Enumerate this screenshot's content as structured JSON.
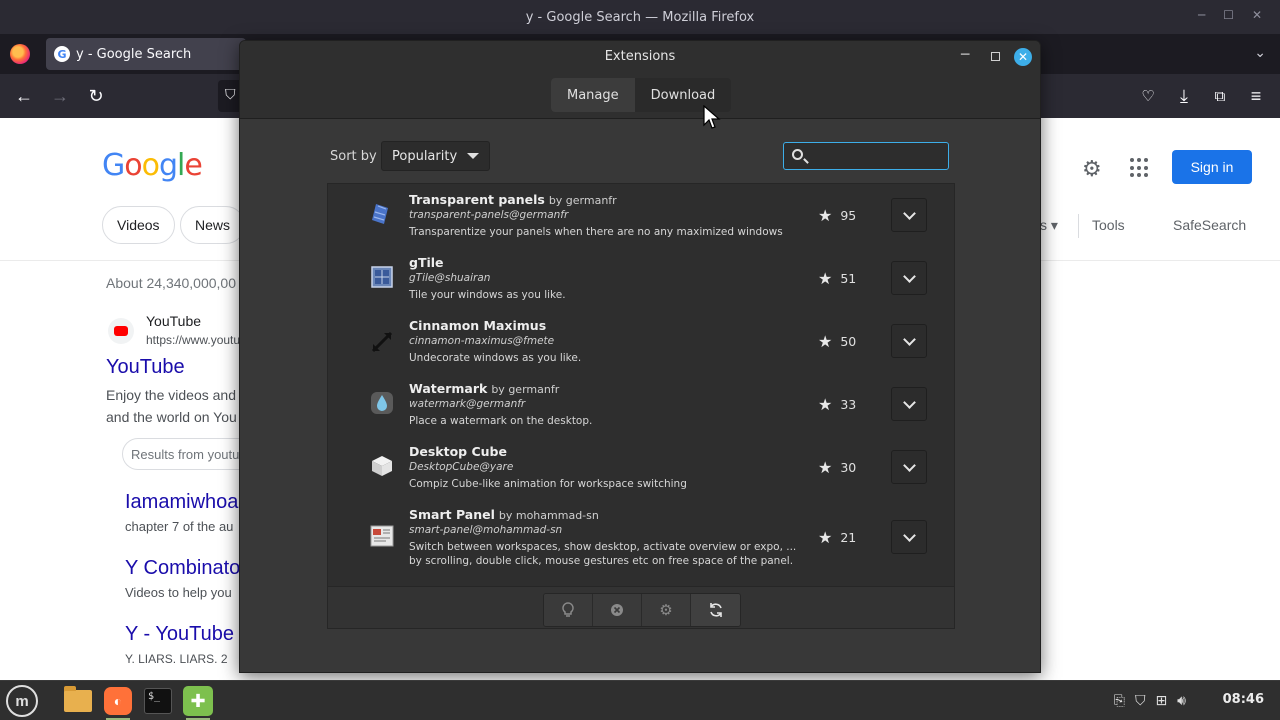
{
  "firefox": {
    "window_title": "y - Google Search — Mozilla Firefox",
    "tab_title": "y - Google Search",
    "favicon_letter": "G",
    "nav_icons": [
      "back-icon",
      "forward-icon",
      "reload-icon",
      "shield-icon"
    ],
    "toolbar_icons": [
      "pocket-icon",
      "downloads-icon",
      "extensions-icon",
      "menu-icon"
    ]
  },
  "google": {
    "logo_letters": [
      "G",
      "o",
      "o",
      "g",
      "l",
      "e"
    ],
    "chips": [
      "Videos",
      "News"
    ],
    "tools_partial": "s",
    "tools": "Tools",
    "safesearch": "SafeSearch",
    "signin": "Sign in",
    "stats": "About 24,340,000,00",
    "yt_site": "YouTube",
    "yt_url": "https://www.youtu",
    "results": [
      {
        "title": "YouTube",
        "snippet1": "Enjoy the videos and",
        "snippet2": "and the world on You"
      },
      {
        "title": "Iamamiwhoa",
        "snippet1": "chapter 7 of the au"
      },
      {
        "title": "Y Combinato",
        "snippet1": "Videos to help you"
      },
      {
        "title": "Y - YouTube",
        "snippet1": "Y. LIARS. LIARS. 2"
      }
    ],
    "results_from": "Results from youtu"
  },
  "extensions": {
    "title": "Extensions",
    "tabs": [
      {
        "label": "Manage",
        "active": false
      },
      {
        "label": "Download",
        "active": true
      }
    ],
    "sort_label": "Sort by",
    "sort_value": "Popularity",
    "search_value": "",
    "items": [
      {
        "name": "Transparent panels",
        "author": "by germanfr",
        "uuid": "transparent-panels@germanfr",
        "desc": "Transparentize your panels when there are no any maximized windows",
        "rating": "95",
        "icon": "transparent-panels-icon"
      },
      {
        "name": "gTile",
        "author": "",
        "uuid": "gTile@shuairan",
        "desc": "Tile your windows as you like.",
        "rating": "51",
        "icon": "gtile-icon"
      },
      {
        "name": "Cinnamon Maximus",
        "author": "",
        "uuid": "cinnamon-maximus@fmete",
        "desc": "Undecorate windows as you like.",
        "rating": "50",
        "icon": "maximus-icon"
      },
      {
        "name": "Watermark",
        "author": "by germanfr",
        "uuid": "watermark@germanfr",
        "desc": "Place a watermark on the desktop.",
        "rating": "33",
        "icon": "watermark-icon"
      },
      {
        "name": "Desktop Cube",
        "author": "",
        "uuid": "DesktopCube@yare",
        "desc": "Compiz Cube-like animation for workspace switching",
        "rating": "30",
        "icon": "desktop-cube-icon"
      },
      {
        "name": "Smart Panel",
        "author": "by mohammad-sn",
        "uuid": "smart-panel@mohammad-sn",
        "desc": "Switch between workspaces, show desktop, activate overview or expo, ... by scrolling, double click, mouse gestures etc on free space of the panel.",
        "rating": "21",
        "icon": "smart-panel-icon"
      }
    ],
    "bottom_buttons": [
      "lightbulb-icon",
      "remove-icon",
      "configure-icon",
      "refresh-icon"
    ]
  },
  "taskbar": {
    "menu_icon": "mint-menu-icon",
    "apps": [
      "files-icon",
      "firefox-icon",
      "terminal-icon",
      "extensions-icon"
    ],
    "terminal_prompt": "$_",
    "tray_icons": [
      "clipboard-icon",
      "update-shield-icon",
      "network-icon",
      "volume-icon"
    ],
    "clock": "08:46"
  }
}
